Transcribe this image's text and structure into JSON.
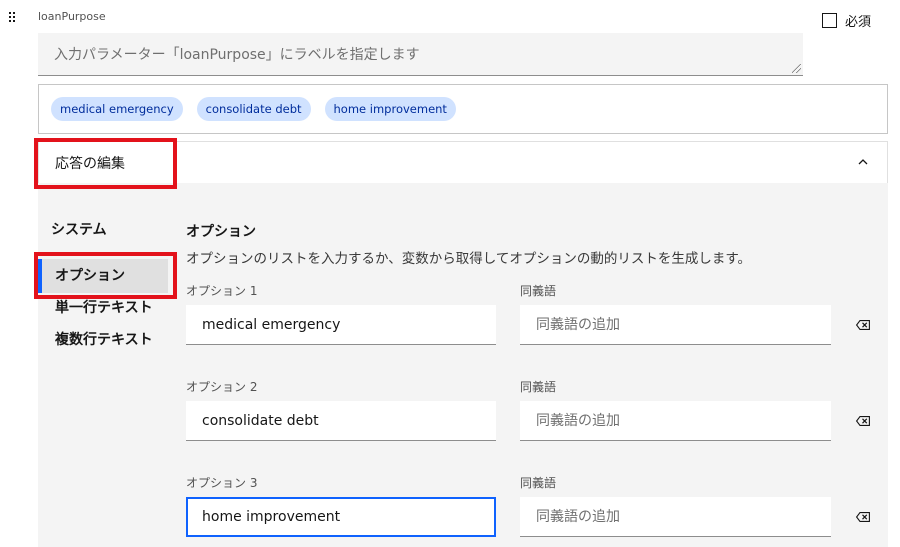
{
  "param": {
    "name": "loanPurpose",
    "label_placeholder": "入力パラメーター「loanPurpose」にラベルを指定します",
    "required_label": "必須"
  },
  "tags": [
    "medical emergency",
    "consolidate debt",
    "home improvement"
  ],
  "accordion": {
    "title": "応答の編集",
    "icon": "chevron-up-icon"
  },
  "nav": {
    "heading": "システム",
    "items": [
      "オプション",
      "単一行テキスト",
      "複数行テキスト"
    ],
    "active_index": 0
  },
  "section": {
    "title": "オプション",
    "description": "オプションのリストを入力するか、変数から取得してオプションの動的リストを生成します。"
  },
  "options": [
    {
      "label": "オプション 1",
      "value": "medical emergency",
      "synonyms_label": "同義語",
      "synonyms_placeholder": "同義語の追加"
    },
    {
      "label": "オプション 2",
      "value": "consolidate debt",
      "synonyms_label": "同義語",
      "synonyms_placeholder": "同義語の追加"
    },
    {
      "label": "オプション 3",
      "value": "home improvement",
      "synonyms_label": "同義語",
      "synonyms_placeholder": "同義語の追加"
    }
  ],
  "colors": {
    "accent": "#0f62fe",
    "tag_bg": "#d0e2ff",
    "tag_text": "#002d9c",
    "highlight": "#e3121b"
  }
}
